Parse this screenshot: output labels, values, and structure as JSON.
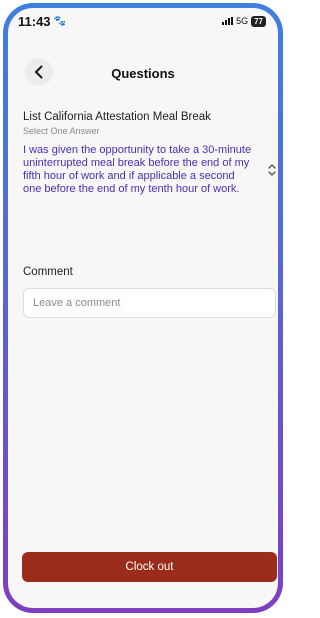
{
  "status": {
    "time": "11:43",
    "network": "5G",
    "battery": "77"
  },
  "header": {
    "title": "Questions"
  },
  "question": {
    "label": "List California Attestation Meal Break",
    "hint": "Select One Answer",
    "selected_answer": "I was given the opportunity to take a 30-minute uninterrupted meal break before the end of my fifth hour of work and if applicable a second one before the end of my tenth hour of work."
  },
  "comment": {
    "label": "Comment",
    "placeholder": "Leave a comment",
    "value": ""
  },
  "footer": {
    "clock_out_label": "Clock out"
  },
  "colors": {
    "accent": "#9b2b1a",
    "answer_text": "#4a2fb3",
    "frame_top": "#3f7fe0",
    "frame_bottom": "#7d3fbf"
  },
  "icons": {
    "back": "chevron-left-icon",
    "status_pet": "paw-icon",
    "select_toggle": "chevron-up-down-icon"
  }
}
